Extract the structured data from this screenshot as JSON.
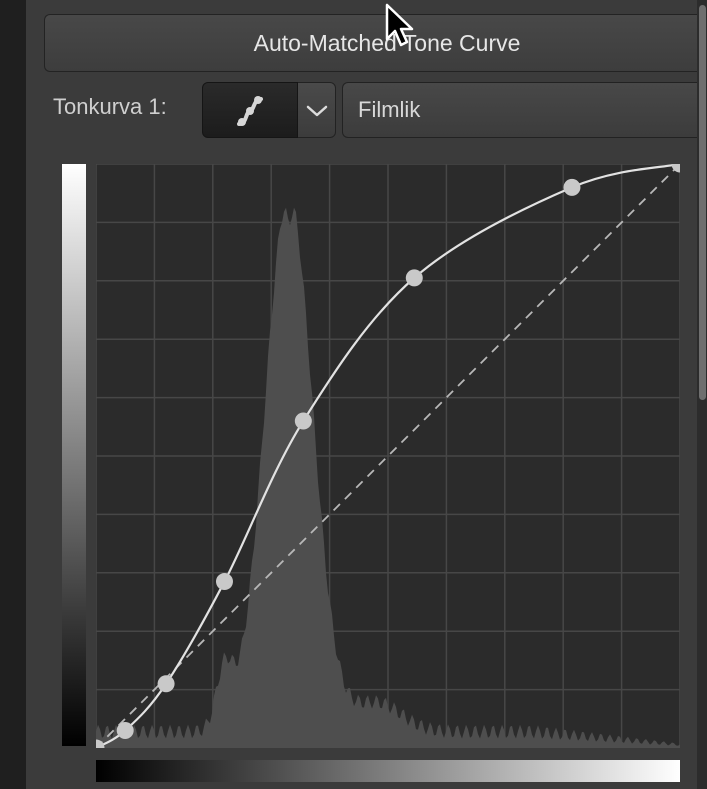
{
  "header": {
    "auto_match_label": "Auto-Matched Tone Curve"
  },
  "tone_curve": {
    "label": "Tonkurva 1:",
    "mode_value": "Filmlik",
    "curve_type_icon": "spline-curve-icon",
    "dropdown_icon": "chevron-down-icon",
    "control_points": [
      [
        0,
        0
      ],
      [
        0.05,
        0.03
      ],
      [
        0.12,
        0.11
      ],
      [
        0.22,
        0.285
      ],
      [
        0.355,
        0.56
      ],
      [
        0.545,
        0.805
      ],
      [
        0.815,
        0.96
      ],
      [
        1,
        1
      ]
    ]
  },
  "colors": {
    "graph_background": "#2b2b2b",
    "grid": "#474747",
    "histogram": "#4e4e4e",
    "curve": "#e2e2e2",
    "control_point": "#c9c9c9"
  }
}
